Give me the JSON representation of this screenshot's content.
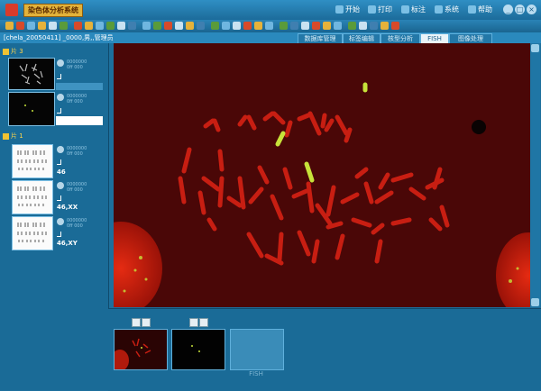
{
  "app": {
    "title": "染色体分析系统",
    "menu": [
      {
        "label": "开始"
      },
      {
        "label": "打印"
      },
      {
        "label": "标注"
      },
      {
        "label": "系统"
      },
      {
        "label": "帮助"
      }
    ]
  },
  "window_controls": [
    "_",
    "□",
    "×"
  ],
  "path_text": "[chela_20050411] _0000,男,,管理员",
  "tabs": [
    {
      "label": "数据库管理",
      "active": false
    },
    {
      "label": "标签编辑",
      "active": false
    },
    {
      "label": "核型分析",
      "active": false
    },
    {
      "label": "FISH",
      "active": true
    },
    {
      "label": "图像处理",
      "active": false
    }
  ],
  "groups": [
    {
      "label": "片 3",
      "items": [
        {
          "kind": "dark-metaphase",
          "info": [
            "0000000",
            "0ff 000"
          ]
        },
        {
          "kind": "dark-fish",
          "info": [
            "0000000",
            "0ff 000"
          ]
        }
      ]
    },
    {
      "label": "片 1",
      "items": [
        {
          "kind": "karyotype",
          "label": "46",
          "info": [
            "0000000",
            "0ff 000"
          ]
        },
        {
          "kind": "karyotype",
          "label": "46,XX",
          "info": [
            "0000000",
            "0ff 000"
          ]
        },
        {
          "kind": "karyotype",
          "label": "46,XY",
          "info": [
            "0000000",
            "0ff 000"
          ]
        }
      ]
    }
  ],
  "bottom_strip": {
    "caption": "FISH"
  },
  "colors": {
    "chromosome": "#c81e12",
    "probe": "#c7e23a",
    "background": "#4a0707",
    "panel": "#1a6b97"
  }
}
